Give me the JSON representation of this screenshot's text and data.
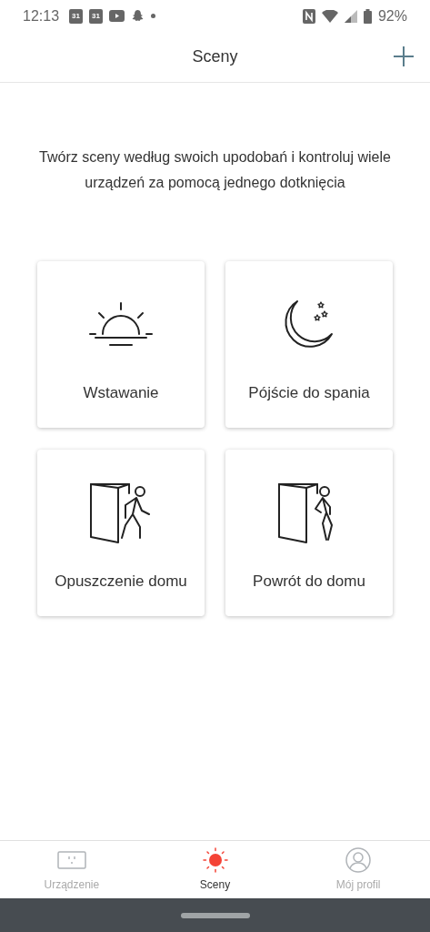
{
  "status_bar": {
    "time": "12:13",
    "notifications": [
      {
        "kind": "calendar",
        "label": "31"
      },
      {
        "kind": "calendar",
        "label": "31"
      },
      {
        "kind": "video"
      },
      {
        "kind": "ghost"
      },
      {
        "kind": "dot"
      }
    ],
    "battery": "92%"
  },
  "header": {
    "title": "Sceny"
  },
  "intro": "Twórz sceny według swoich upodobań i kontroluj wiele urządzeń za pomocą jednego dotknięcia",
  "scenes": [
    {
      "kind": "sunrise",
      "label": "Wstawanie"
    },
    {
      "kind": "moon",
      "label": "Pójście do spania"
    },
    {
      "kind": "leave",
      "label": "Opuszczenie domu"
    },
    {
      "kind": "return",
      "label": "Powrót do domu"
    }
  ],
  "nav": [
    {
      "kind": "outlet",
      "label": "Urządzenie",
      "selected": false
    },
    {
      "kind": "sun",
      "label": "Sceny",
      "selected": true
    },
    {
      "kind": "profile",
      "label": "Mój profil",
      "selected": false
    }
  ]
}
